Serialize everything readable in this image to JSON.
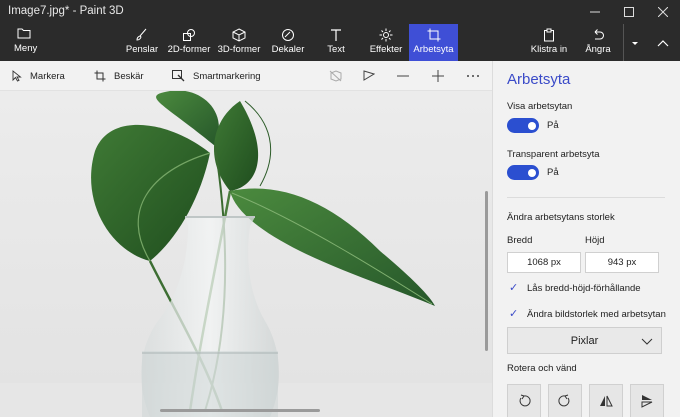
{
  "window": {
    "title": "Image7.jpg* - Paint 3D"
  },
  "ribbon": {
    "menu_label": "Meny",
    "tools": [
      {
        "label": "Penslar",
        "icon": "brush-icon"
      },
      {
        "label": "2D-former",
        "icon": "2d-shapes-icon"
      },
      {
        "label": "3D-former",
        "icon": "3d-shapes-icon"
      },
      {
        "label": "Dekaler",
        "icon": "stickers-icon"
      },
      {
        "label": "Text",
        "icon": "text-icon"
      },
      {
        "label": "Effekter",
        "icon": "effects-icon"
      },
      {
        "label": "Arbetsyta",
        "icon": "canvas-icon",
        "active": true
      }
    ],
    "paste_label": "Klistra in",
    "undo_label": "Ångra"
  },
  "toolbar": {
    "select_label": "Markera",
    "crop_label": "Beskär",
    "magic_select_label": "Smartmarkering"
  },
  "panel": {
    "title": "Arbetsyta",
    "show_canvas_label": "Visa arbetsytan",
    "show_canvas_state": "På",
    "transparent_label": "Transparent arbetsyta",
    "transparent_state": "På",
    "resize_heading": "Ändra arbetsytans storlek",
    "width_label": "Bredd",
    "height_label": "Höjd",
    "width_value": "1068 px",
    "height_value": "943 px",
    "lock_ratio_label": "Lås bredd-höjd-förhållande",
    "resize_image_label": "Ändra bildstorlek med arbetsytan",
    "unit_selected": "Pixlar",
    "rotate_heading": "Rotera och vänd"
  },
  "colors": {
    "accent": "#3b4bc8",
    "ribbon_bg": "#2b2b2b",
    "active_tab": "#3f4fd6",
    "toggle_on": "#2b4fd0"
  }
}
